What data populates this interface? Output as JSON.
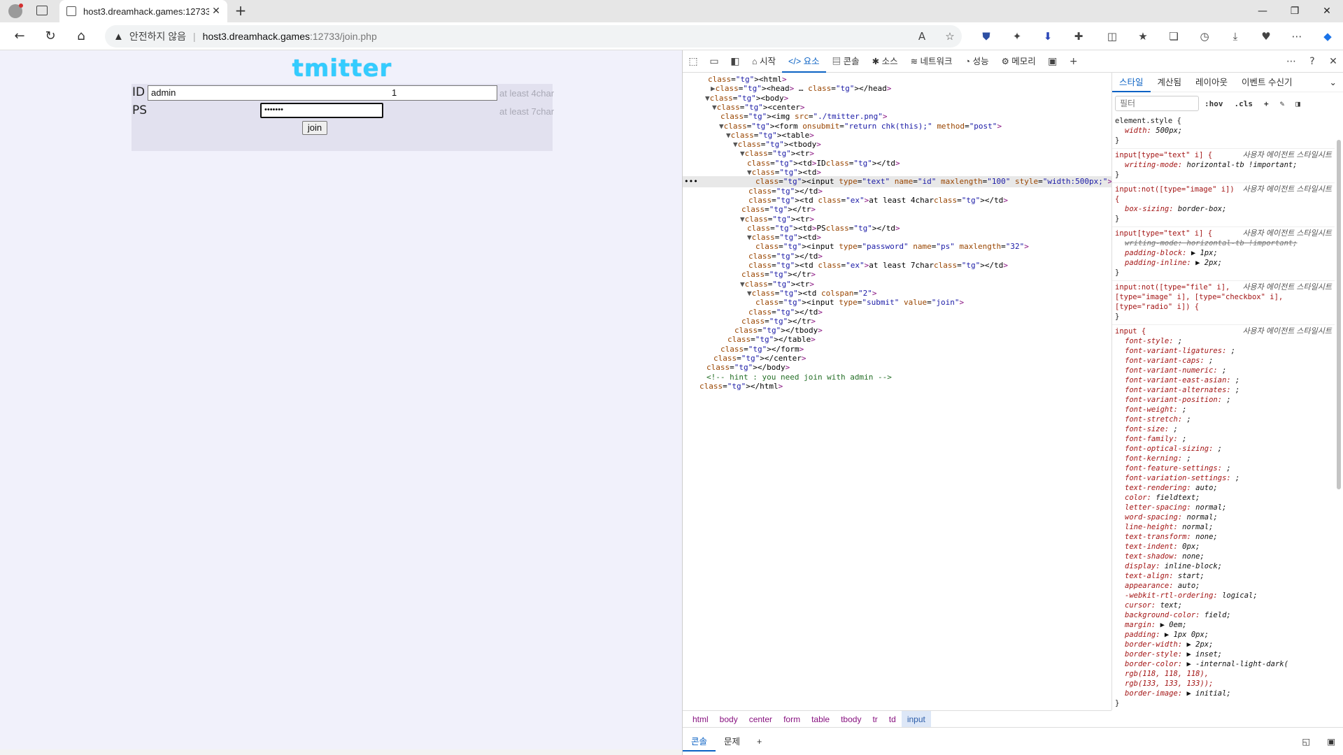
{
  "browser": {
    "tab_title": "host3.dreamhack.games:12733/j",
    "tab_close": "✕",
    "new_tab": "+",
    "insecure_label": "안전하지 않음",
    "url_host": "host3.dreamhack.games",
    "url_path": ":12733/join.php"
  },
  "page": {
    "logo_text": "tmitter",
    "id_label": "ID",
    "id_value": "admin",
    "id_suffix": "1",
    "id_hint": "at least 4char",
    "ps_label": "PS",
    "ps_value": "•••••••",
    "ps_hint": "at least 7char",
    "join_label": "join"
  },
  "devtools": {
    "tabs": [
      "시작",
      "요소",
      "콘솔",
      "소스",
      "네트워크",
      "성능",
      "메모리"
    ],
    "active_tab": "요소",
    "dom_lines": [
      "<html>",
      "▶<head> … </head>",
      "▼<body>",
      "▼<center>",
      "<img src=\"./tmitter.png\">",
      "▼<form onsubmit=\"return chk(this);\" method=\"post\">",
      "▼<table>",
      "▼<tbody>",
      "▼<tr>",
      "<td>ID</td>",
      "▼<td>",
      "<input type=\"text\" name=\"id\" maxlength=\"100\" style=\"width:500px;\"> == $0",
      "</td>",
      "<td class=\"ex\">at least 4char</td>",
      "</tr>",
      "▼<tr>",
      "<td>PS</td>",
      "▼<td>",
      "<input type=\"password\" name=\"ps\" maxlength=\"32\">",
      "</td>",
      "<td class=\"ex\">at least 7char</td>",
      "</tr>",
      "▼<tr>",
      "▼<td colspan=\"2\">",
      "<input type=\"submit\" value=\"join\">",
      "</td>",
      "</tr>",
      "</tbody>",
      "</table>",
      "</form>",
      "</center>",
      "</body>",
      "<!-- hint : you need join with admin -->",
      "</html>"
    ],
    "breadcrumbs": [
      "html",
      "body",
      "center",
      "form",
      "table",
      "tbody",
      "tr",
      "td",
      "input"
    ],
    "drawer_tabs": [
      "콘솔",
      "문제"
    ],
    "styles_tabs": [
      "스타일",
      "계산됨",
      "레이아웃",
      "이벤트 수신기"
    ],
    "filter_placeholder": "필터",
    "filter_hov": ":hov",
    "filter_cls": ".cls",
    "ua_label": "사용자 에이전트 스타일시트",
    "rules": [
      {
        "selector": "element.style {",
        "ua": false,
        "props": [
          "width: 500px;"
        ]
      },
      {
        "selector": "input[type=\"text\" i] {",
        "ua": true,
        "props": [
          "writing-mode: horizontal-tb !important;"
        ]
      },
      {
        "selector": "input:not([type=\"image\" i]) {",
        "ua": true,
        "props": [
          "box-sizing: border-box;"
        ]
      },
      {
        "selector": "input[type=\"text\" i] {",
        "ua": true,
        "props": [
          "~writing-mode: horizontal-tb !important;",
          "padding-block: ▶ 1px;",
          "padding-inline: ▶ 2px;"
        ]
      },
      {
        "selector": "input:not([type=\"file\" i], [type=\"image\" i], [type=\"checkbox\" i], [type=\"radio\" i]) {",
        "ua": true,
        "props": []
      },
      {
        "selector": "input {",
        "ua": true,
        "props": [
          "font-style: ;",
          "font-variant-ligatures: ;",
          "font-variant-caps: ;",
          "font-variant-numeric: ;",
          "font-variant-east-asian: ;",
          "font-variant-alternates: ;",
          "font-variant-position: ;",
          "font-weight: ;",
          "font-stretch: ;",
          "font-size: ;",
          "font-family: ;",
          "font-optical-sizing: ;",
          "font-kerning: ;",
          "font-feature-settings: ;",
          "font-variation-settings: ;",
          "text-rendering: auto;",
          "color: fieldtext;",
          "letter-spacing: normal;",
          "word-spacing: normal;",
          "line-height: normal;",
          "text-transform: none;",
          "text-indent: 0px;",
          "text-shadow: none;",
          "display: inline-block;",
          "text-align: start;",
          "appearance: auto;",
          "-webkit-rtl-ordering: logical;",
          "cursor: text;",
          "background-color: field;",
          "margin: ▶ 0em;",
          "padding: ▶ 1px 0px;",
          "border-width: ▶ 2px;",
          "border-style: ▶ inset;",
          "border-color: ▶ -internal-light-dark(",
          "rgb(118, 118, 118),",
          "rgb(133, 133, 133));",
          "border-image: ▶ initial;"
        ]
      }
    ]
  }
}
